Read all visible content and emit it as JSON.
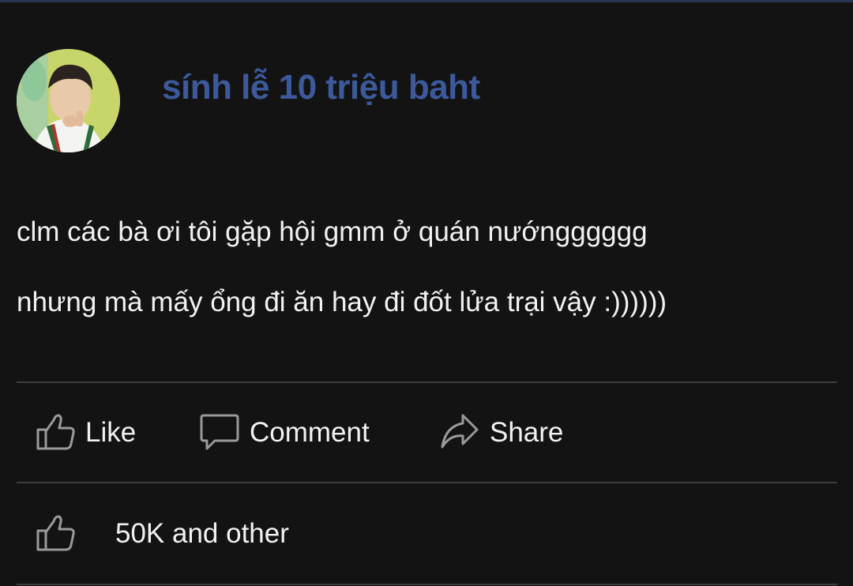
{
  "post": {
    "author": "sính lễ 10 triệu baht",
    "lines": [
      "clm các bà ơi tôi gặp hội gmm ở quán nướngggggg",
      "nhưng mà mấy ổng đi ăn hay đi đốt lửa trại vậy :))))))"
    ]
  },
  "actions": {
    "like": {
      "label": "Like",
      "icon": "thumbs-up-icon"
    },
    "comment": {
      "label": "Comment",
      "icon": "speech-bubble-icon"
    },
    "share": {
      "label": "Share",
      "icon": "share-arrow-icon"
    }
  },
  "reactions": {
    "icon": "thumbs-up-icon",
    "summary": "50K and other"
  },
  "colors": {
    "background": "#131313",
    "author_name": "#3c5a9b",
    "text": "#f2f2f2",
    "divider": "#3d3d3f",
    "icon_stroke": "#9a9a9a"
  }
}
